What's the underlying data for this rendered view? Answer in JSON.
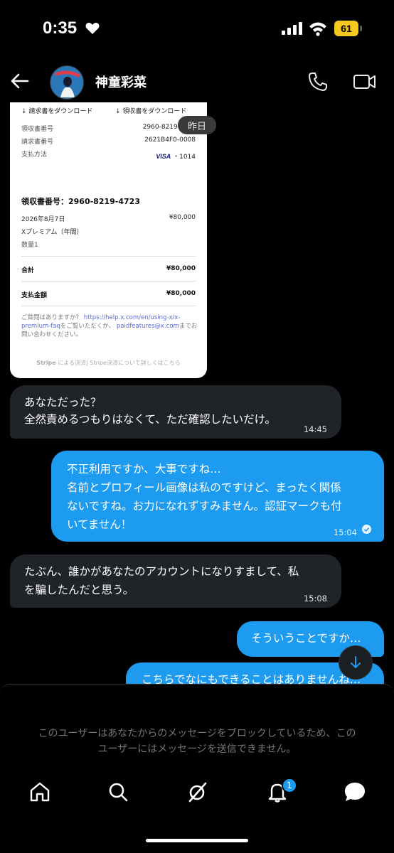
{
  "status": {
    "time": "0:35",
    "battery": "61"
  },
  "header": {
    "name": "神童彩菜"
  },
  "receipt": {
    "download_invoice": "請求書をダウンロード",
    "download_receipt": "領収書をダウンロード",
    "rows": [
      {
        "label": "領収書番号",
        "value": "2960-8219-"
      },
      {
        "label": "請求書番号",
        "value": "2621B4F0-0008"
      },
      {
        "label": "支払方法",
        "value": "・1014",
        "brand": "VISA"
      }
    ],
    "receipt_number": "領収書番号：2960-8219-4723",
    "date": "2026年8月7日",
    "date_amount": "¥80,000",
    "item": "Xプレミアム（年間）",
    "qty": "数量1",
    "total_label": "合計",
    "total_amount": "¥80,000",
    "paid_label": "支払金額",
    "paid_amount": "¥80,000",
    "question_prefix": "ご質問はありますか？",
    "question_link": "https://help.x.com/en/using-x/x-premium-faq",
    "question_mid": "をご覧いただくか、",
    "question_email": "paidfeatures@x.com",
    "question_suffix": "までお問い合わせください。",
    "stripe_brand": "Stripe",
    "stripe_text": " による決済| Stripe決済について詳しくはこちら"
  },
  "date_pill": "昨日",
  "messages": [
    {
      "dir": "in",
      "lines": [
        "あなただった？",
        "全然責めるつもりはなくて、ただ確認したいだけ。"
      ],
      "time": "14:45"
    },
    {
      "dir": "out",
      "lines": [
        "不正利用ですか、大事ですね…",
        "名前とプロフィール画像は私のですけど、まったく関係",
        "ないですね。お力になれずすみません。認証マークも付",
        "いてません！"
      ],
      "time": "15:04"
    },
    {
      "dir": "in",
      "lines": [
        "たぶん、誰かがあなたのアカウントになりすまして、私",
        "を騙したんだと思う。"
      ],
      "time": "15:08"
    },
    {
      "dir": "out",
      "lines": [
        "そういうことですか…"
      ]
    },
    {
      "dir": "out",
      "lines": [
        "こちらでなにもできることはありませんね…"
      ]
    }
  ],
  "block_notice": [
    "このユーザーはあなたからのメッセージをブロックしているため、この",
    "ユーザーにはメッセージを送信できません。"
  ],
  "tabs": [
    {
      "name": "home-icon"
    },
    {
      "name": "search-icon"
    },
    {
      "name": "grok-icon"
    },
    {
      "name": "notifications-icon",
      "badge": "1"
    },
    {
      "name": "messages-icon"
    }
  ],
  "colors": {
    "accent": "#1d9bf0",
    "incoming_bubble": "#202327",
    "background": "#000000"
  }
}
